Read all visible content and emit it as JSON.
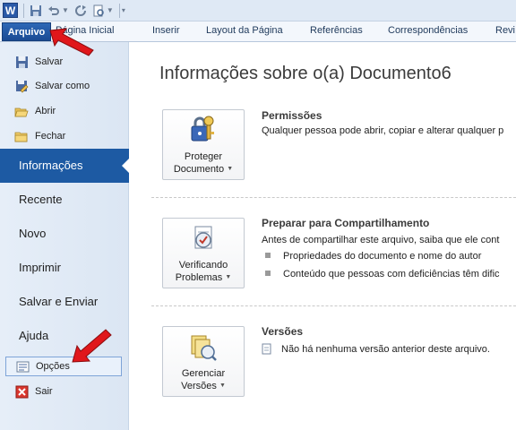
{
  "quick_access": {
    "app_icon": "W",
    "icons": [
      "save-icon",
      "undo-icon",
      "redo-icon",
      "print-preview-icon",
      "customize-icon"
    ]
  },
  "ribbon": {
    "tabs": [
      {
        "label": "Arquivo"
      },
      {
        "label": "Página Inicial"
      },
      {
        "label": "Inserir"
      },
      {
        "label": "Layout da Página"
      },
      {
        "label": "Referências"
      },
      {
        "label": "Correspondências"
      },
      {
        "label": "Revi"
      }
    ]
  },
  "nav": {
    "commands_top": [
      {
        "label": "Salvar",
        "icon": "save-icon"
      },
      {
        "label": "Salvar como",
        "icon": "save-as-icon"
      },
      {
        "label": "Abrir",
        "icon": "open-folder-icon"
      },
      {
        "label": "Fechar",
        "icon": "close-folder-icon"
      }
    ],
    "sections": [
      {
        "label": "Informações"
      },
      {
        "label": "Recente"
      },
      {
        "label": "Novo"
      },
      {
        "label": "Imprimir"
      },
      {
        "label": "Salvar e Enviar"
      },
      {
        "label": "Ajuda"
      }
    ],
    "commands_bottom": [
      {
        "label": "Opções",
        "icon": "options-icon"
      },
      {
        "label": "Sair",
        "icon": "exit-icon"
      }
    ]
  },
  "main": {
    "title": "Informações sobre o(a) Documento6",
    "permissions": {
      "button_line1": "Proteger",
      "button_line2": "Documento",
      "title": "Permissões",
      "text": "Qualquer pessoa pode abrir, copiar e alterar qualquer p"
    },
    "sharing": {
      "button_line1": "Verificando",
      "button_line2": "Problemas",
      "title": "Preparar para Compartilhamento",
      "text": "Antes de compartilhar este arquivo, saiba que ele cont",
      "bullets": [
        "Propriedades do documento e nome do autor",
        "Conteúdo que pessoas com deficiências têm dific"
      ]
    },
    "versions": {
      "button_line1": "Gerenciar",
      "button_line2": "Versões",
      "title": "Versões",
      "text": "Não há nenhuma versão anterior deste arquivo."
    }
  },
  "colors": {
    "accent": "#1d5aa3",
    "arrow": "#e0171b"
  }
}
